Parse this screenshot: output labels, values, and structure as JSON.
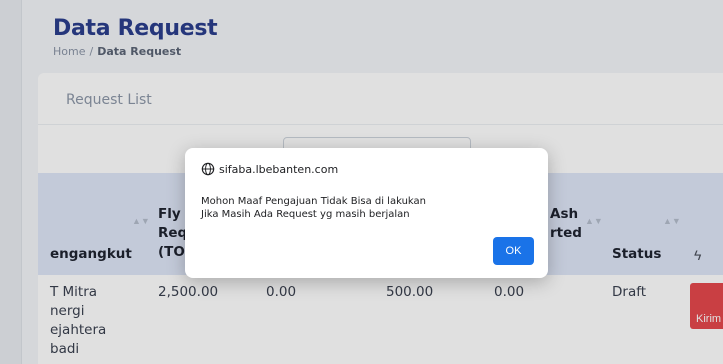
{
  "page": {
    "title": "Data Request",
    "breadcrumb": {
      "home": "Home",
      "separator": "/",
      "current": "Data Request"
    }
  },
  "card": {
    "title": "Request List"
  },
  "table": {
    "headers": {
      "pengangkut": "engangkut",
      "fly_line1": "Fly A",
      "fly_line2": "Req",
      "fly_line3": "(TO",
      "ash_line1": "Ash",
      "ash_line2": "rted",
      "status": "Status",
      "action_icon": "bolt-icon"
    },
    "row": {
      "pengangkut_line1": "T Mitra",
      "pengangkut_line2": "nergi",
      "pengangkut_line3": "ejahtera",
      "pengangkut_line4": "badi",
      "fly_ash_request": "2,500.00",
      "col3": "0.00",
      "col4": "500.00",
      "col5": "0.00",
      "status": "Draft",
      "action_label": "Kirim"
    }
  },
  "dialog": {
    "origin": "sifaba.lbebanten.com",
    "message_line1": "Mohon Maaf Pengajuan Tidak Bisa di lakukan",
    "message_line2": "Jika Masih Ada Request yg masih berjalan",
    "ok_label": "OK",
    "origin_icon": "globe-icon"
  },
  "colors": {
    "title": "#2b3e8c",
    "ok_button": "#1a73e8",
    "kirim_button": "#e5484d",
    "table_head": "#dfe6f8"
  }
}
